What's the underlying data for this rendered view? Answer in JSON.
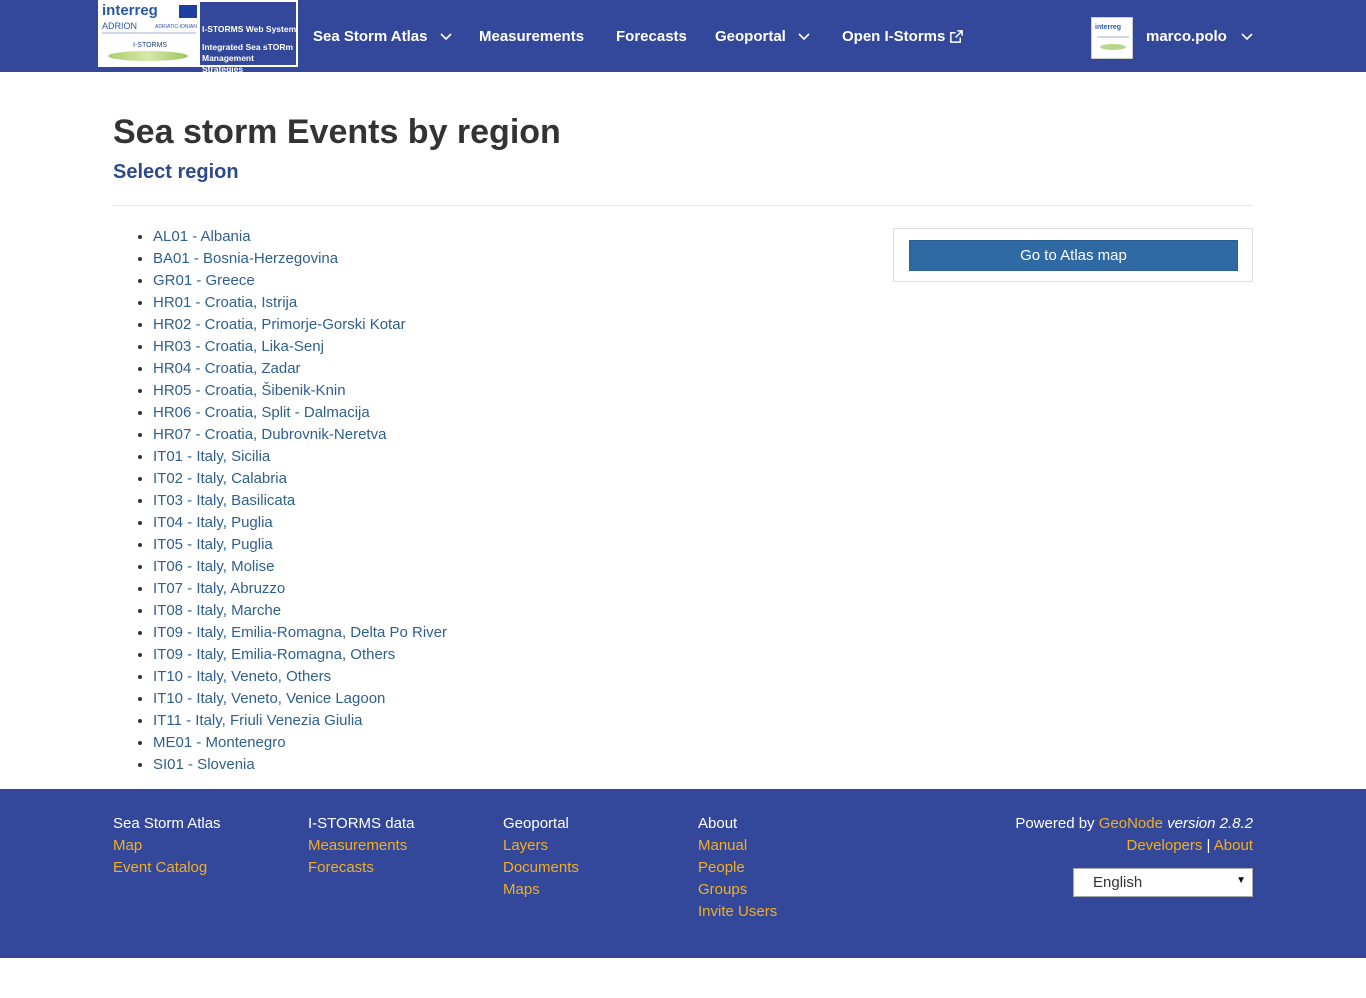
{
  "navbar": {
    "logo": {
      "interreg": "interreg",
      "adrion": "ADRION",
      "adrion_sub": "ADRIATIC-IONIAN",
      "istorms": "I-STORMS",
      "system_title": "I-STORMS Web System",
      "system_sub": "Integrated Sea sTORm Management Strategies"
    },
    "items": [
      {
        "label": "Sea Storm Atlas",
        "has_dropdown": true
      },
      {
        "label": "Measurements"
      },
      {
        "label": "Forecasts"
      },
      {
        "label": "Geoportal",
        "has_dropdown": true
      },
      {
        "label": "Open I-Storms",
        "icon": "external-link-icon"
      }
    ],
    "user": {
      "name": "marco.polo",
      "has_dropdown": true
    }
  },
  "main": {
    "title": "Sea storm Events by region",
    "subtitle": "Select region",
    "regions": [
      "AL01 - Albania",
      "BA01 - Bosnia-Herzegovina",
      "GR01 - Greece",
      "HR01 - Croatia, Istrija",
      "HR02 - Croatia, Primorje-Gorski Kotar",
      "HR03 - Croatia, Lika-Senj",
      "HR04 - Croatia, Zadar",
      "HR05 - Croatia, Šibenik-Knin",
      "HR06 - Croatia, Split - Dalmacija",
      "HR07 - Croatia, Dubrovnik-Neretva",
      "IT01 - Italy, Sicilia",
      "IT02 - Italy, Calabria",
      "IT03 - Italy, Basilicata",
      "IT04 - Italy, Puglia",
      "IT05 - Italy, Puglia",
      "IT06 - Italy, Molise",
      "IT07 - Italy, Abruzzo",
      "IT08 - Italy, Marche",
      "IT09 - Italy, Emilia-Romagna, Delta Po River",
      "IT09 - Italy, Emilia-Romagna, Others",
      "IT10 - Italy, Veneto, Others",
      "IT10 - Italy, Veneto, Venice Lagoon",
      "IT11 - Italy, Friuli Venezia Giulia",
      "ME01 - Montenegro",
      "SI01 - Slovenia"
    ],
    "atlas_button": "Go to Atlas map"
  },
  "footer": {
    "columns": [
      {
        "heading": "Sea Storm Atlas",
        "links": [
          "Map",
          "Event Catalog"
        ]
      },
      {
        "heading": "I-STORMS data",
        "links": [
          "Measurements",
          "Forecasts"
        ]
      },
      {
        "heading": "Geoportal",
        "links": [
          "Layers",
          "Documents",
          "Maps"
        ]
      },
      {
        "heading": "About",
        "links": [
          "Manual",
          "People",
          "Groups",
          "Invite Users"
        ]
      }
    ],
    "powered_by": "Powered by",
    "geonode": "GeoNode",
    "version": "version 2.8.2",
    "developers": "Developers",
    "separator": "|",
    "about": "About",
    "language": "English"
  },
  "colors": {
    "navbar_bg": "#33479b",
    "link": "#2e5f8f",
    "footer_link": "#f2b01e",
    "button_bg": "#2f6aa4"
  }
}
